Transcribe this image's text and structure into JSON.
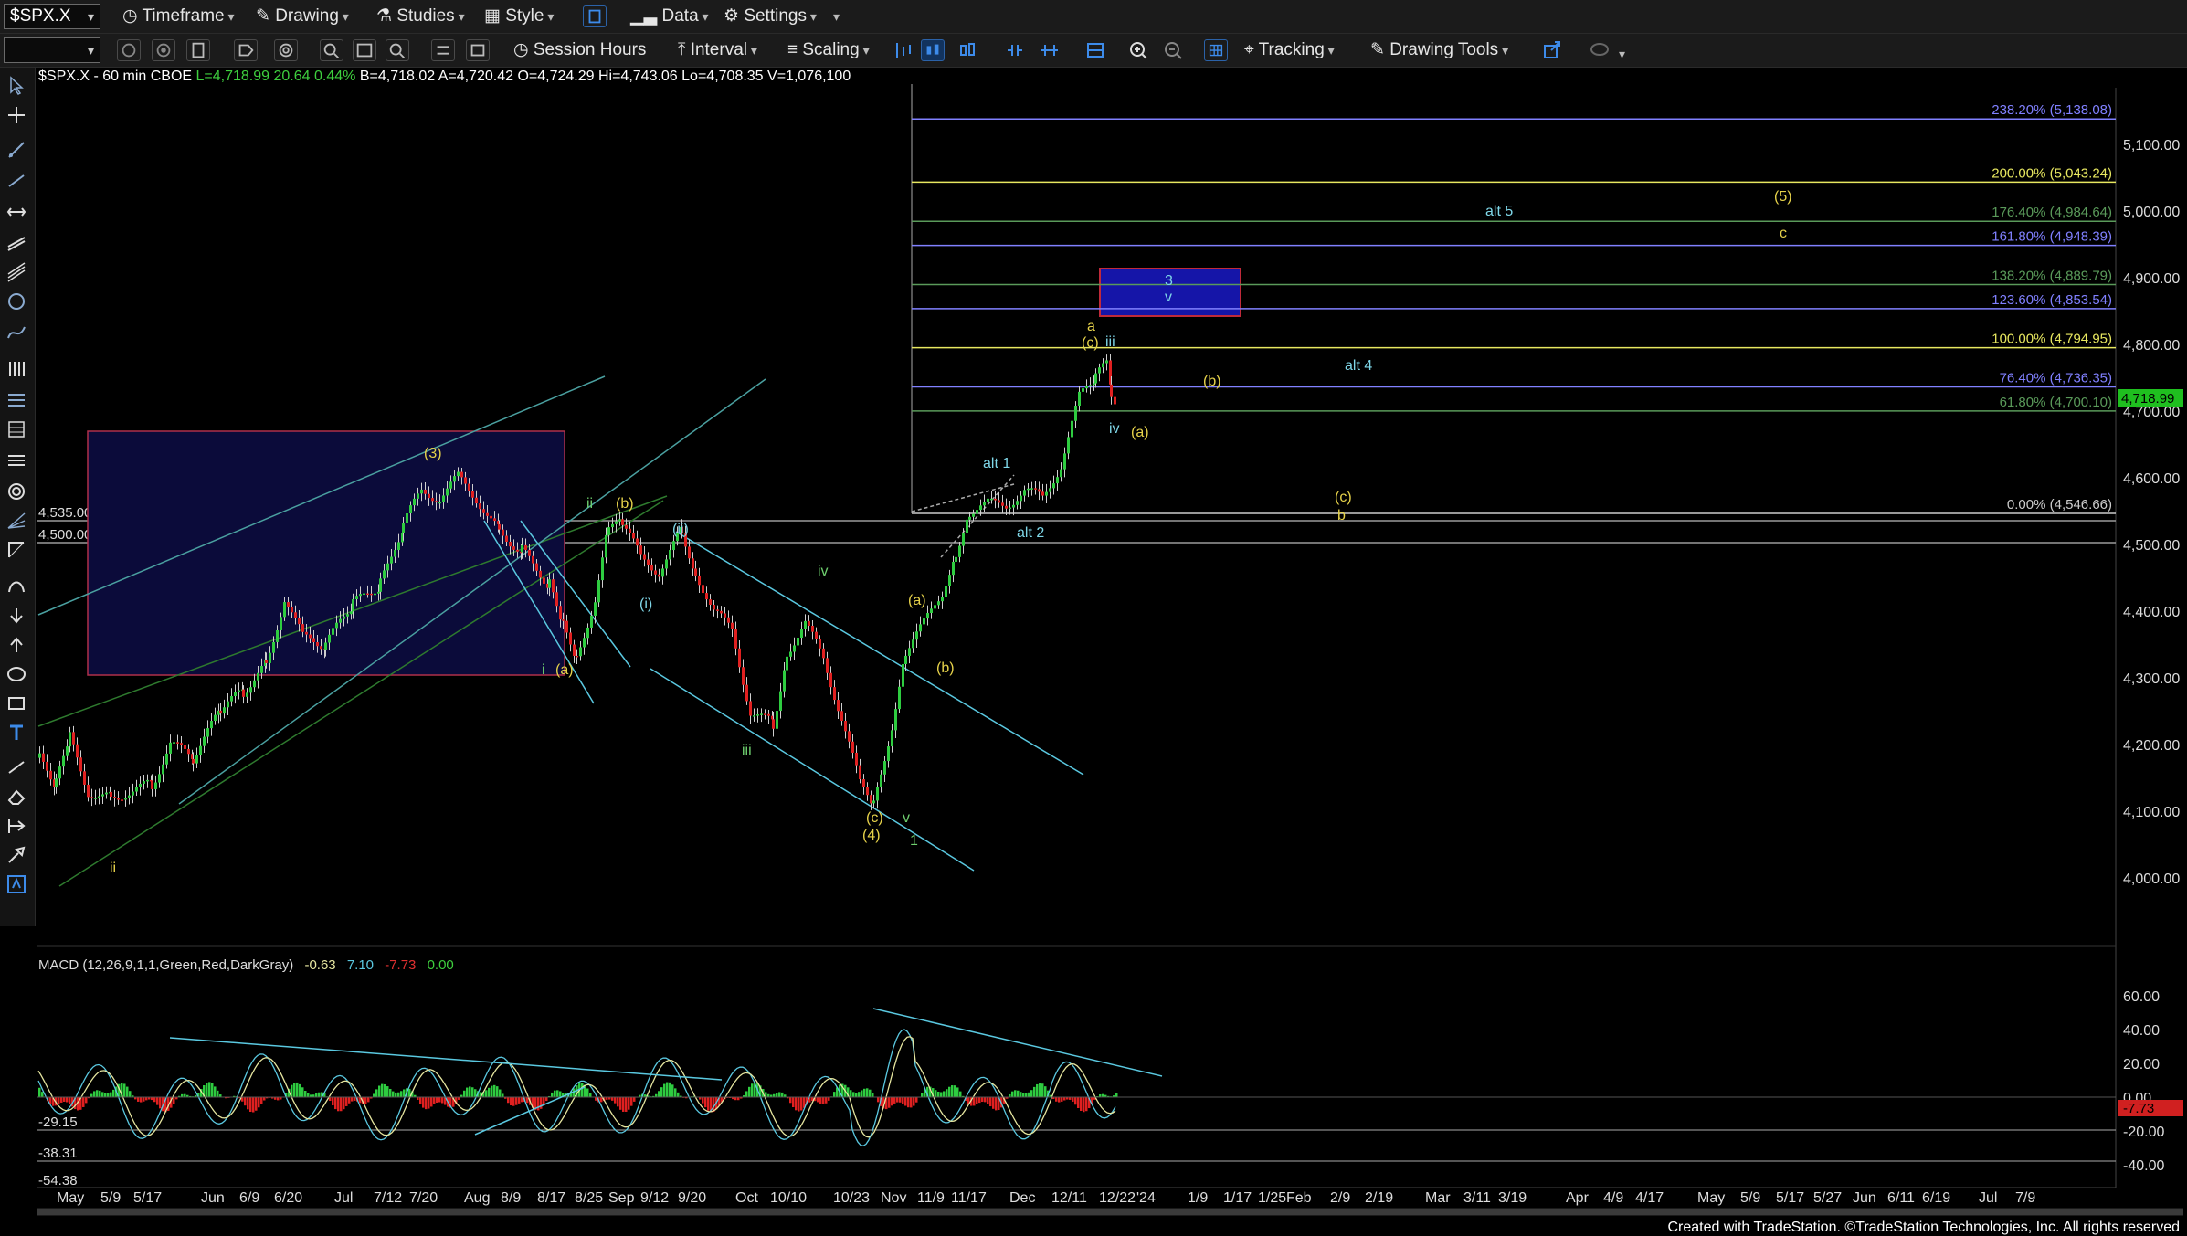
{
  "toolbar1": {
    "symbol": "$SPX.X",
    "timeframe": "Timeframe",
    "drawing": "Drawing",
    "studies": "Studies",
    "style": "Style",
    "data": "Data",
    "settings": "Settings"
  },
  "toolbar2": {
    "session_hours": "Session Hours",
    "interval": "Interval",
    "scaling": "Scaling",
    "tracking": "Tracking",
    "drawing_tools": "Drawing Tools"
  },
  "header": {
    "symbol_info": "$SPX.X - 60 min  CBOE",
    "last": "L=4,718.99",
    "change": "20.64",
    "pct": "0.44%",
    "bid": "B=4,718.02",
    "ask": "A=4,720.42",
    "open": "O=4,724.29",
    "high": "Hi=4,743.06",
    "low": "Lo=4,708.35",
    "volume": "V=1,076,100"
  },
  "price_axis": {
    "ticks": [
      "5,100.00",
      "5,000.00",
      "4,900.00",
      "4,800.00",
      "4,700.00",
      "4,600.00",
      "4,500.00",
      "4,400.00",
      "4,300.00",
      "4,200.00",
      "4,100.00",
      "4,000.00"
    ],
    "last_price": "4,718.99"
  },
  "macd": {
    "label": "MACD (12,26,9,1,1,Green,Red,DarkGray)",
    "v1": "-0.63",
    "v2": "7.10",
    "v3": "-7.73",
    "v4": "0.00",
    "axis_ticks": [
      "60.00",
      "40.00",
      "20.00",
      "0.00",
      "-20.00",
      "-40.00"
    ],
    "badge": "-7.73",
    "left_labels": [
      "-29.15",
      "-38.31",
      "-54.38"
    ]
  },
  "level_labels": [
    "4,535.00",
    "4,500.00"
  ],
  "fib_levels": [
    {
      "label": "238.20% (5,138.08)",
      "price": 5138.08,
      "color": "#8080ff"
    },
    {
      "label": "200.00% (5,043.24)",
      "price": 5043.24,
      "color": "#e8e860"
    },
    {
      "label": "176.40% (4,984.64)",
      "price": 4984.64,
      "color": "#5a9a5a"
    },
    {
      "label": "161.80% (4,948.39)",
      "price": 4948.39,
      "color": "#8080ff"
    },
    {
      "label": "138.20% (4,889.79)",
      "price": 4889.79,
      "color": "#5a9a5a"
    },
    {
      "label": "123.60% (4,853.54)",
      "price": 4853.54,
      "color": "#8080ff"
    },
    {
      "label": "100.00% (4,794.95)",
      "price": 4794.95,
      "color": "#e8e860"
    },
    {
      "label": "76.40% (4,736.35)",
      "price": 4736.35,
      "color": "#8080ff"
    },
    {
      "label": "61.80% (4,700.10)",
      "price": 4700.1,
      "color": "#5a9a5a"
    },
    {
      "label": "0.00% (4,546.66)",
      "price": 4546.66,
      "color": "#cccccc"
    }
  ],
  "wave_labels": [
    {
      "t": "(3)",
      "c": "#e6d24a"
    },
    {
      "t": "ii",
      "c": "#6fd06f"
    },
    {
      "t": "(b)",
      "c": "#e6d24a"
    },
    {
      "t": "(ii)",
      "c": "#7fd7e8"
    },
    {
      "t": "(i)",
      "c": "#7fd7e8"
    },
    {
      "t": "i",
      "c": "#6fd06f"
    },
    {
      "t": "(a)",
      "c": "#e6d24a"
    },
    {
      "t": "iv",
      "c": "#6fd06f"
    },
    {
      "t": "iii",
      "c": "#6fd06f"
    },
    {
      "t": "(a)",
      "c": "#e6d24a"
    },
    {
      "t": "(b)",
      "c": "#e6d24a"
    },
    {
      "t": "(c)",
      "c": "#e6d24a"
    },
    {
      "t": "(4)",
      "c": "#e6d24a"
    },
    {
      "t": "v",
      "c": "#6fd06f"
    },
    {
      "t": "1",
      "c": "#6fd06f"
    },
    {
      "t": "alt 1",
      "c": "#7fd7e8"
    },
    {
      "t": "alt 2",
      "c": "#7fd7e8"
    },
    {
      "t": "a",
      "c": "#e6d24a"
    },
    {
      "t": "(c)",
      "c": "#e6d24a"
    },
    {
      "t": "iii",
      "c": "#7fd7e8"
    },
    {
      "t": "iv",
      "c": "#7fd7e8"
    },
    {
      "t": "(a)",
      "c": "#e6d24a"
    },
    {
      "t": "(b)",
      "c": "#e6d24a"
    },
    {
      "t": "(c)",
      "c": "#e6d24a"
    },
    {
      "t": "b",
      "c": "#e6d24a"
    },
    {
      "t": "alt 4",
      "c": "#7fd7e8"
    },
    {
      "t": "alt 5",
      "c": "#7fd7e8"
    },
    {
      "t": "3",
      "c": "#7fd7e8"
    },
    {
      "t": "v",
      "c": "#7fd7e8"
    },
    {
      "t": "(5)",
      "c": "#e6d24a"
    },
    {
      "t": "c",
      "c": "#e6d24a"
    },
    {
      "t": "ii",
      "c": "#e6d24a"
    }
  ],
  "x_axis": [
    "May",
    "5/9",
    "5/17",
    "Jun",
    "6/9",
    "6/20",
    "Jul",
    "7/12",
    "7/20",
    "Aug",
    "8/9",
    "8/17",
    "8/25",
    "Sep",
    "9/12",
    "9/20",
    "Oct",
    "10/10",
    "10/23",
    "Nov",
    "11/9",
    "11/17",
    "Dec",
    "12/11",
    "12/22",
    "'24",
    "1/9",
    "1/17",
    "1/25",
    "Feb",
    "2/9",
    "2/19",
    "Mar",
    "3/11",
    "3/19",
    "Apr",
    "4/9",
    "4/17",
    "May",
    "5/9",
    "5/17",
    "5/27",
    "Jun",
    "6/11",
    "6/19",
    "Jul",
    "7/9"
  ],
  "footer": "Created with TradeStation. ©TradeStation Technologies, Inc. All rights reserved"
}
